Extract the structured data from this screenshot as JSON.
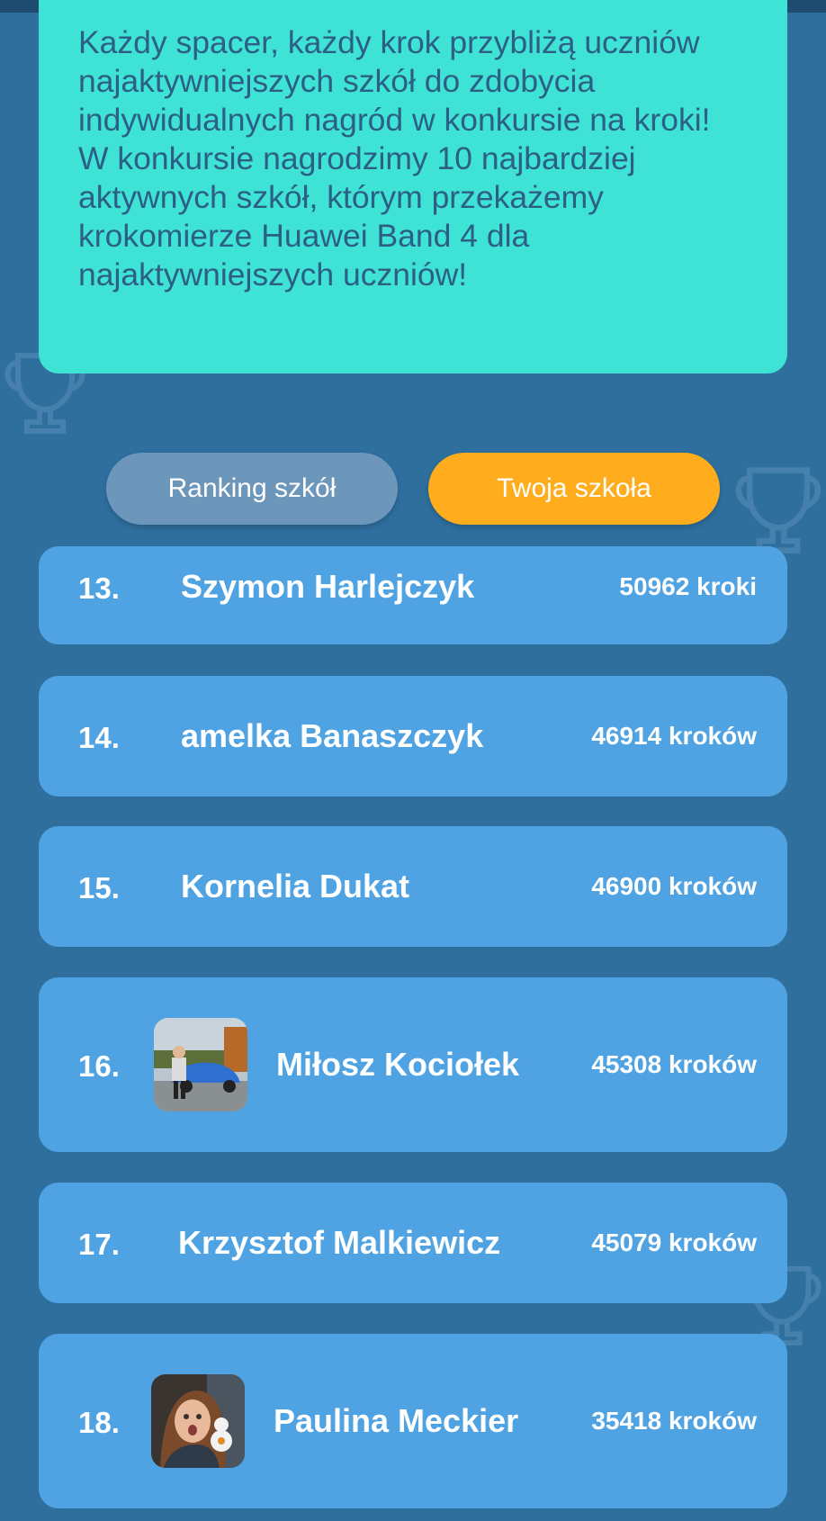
{
  "intro": {
    "text": "Każdy spacer, każdy krok przybliżą uczniów najaktywniejszych szkół do zdobycia indywidualnych nagród w konkursie na kroki! W konkursie nagrodzimy 10 najbardziej aktywnych szkół, którym przekażemy krokomierze Huawei Band 4 dla najaktywniejszych uczniów!"
  },
  "tabs": {
    "ranking_label": "Ranking szkół",
    "school_label": "Twoja szkoła",
    "active": "school"
  },
  "ranking": [
    {
      "rank": "13.",
      "name": "Szymon Harlejczyk",
      "steps": "50962 kroki",
      "avatar": null
    },
    {
      "rank": "14.",
      "name": "amelka Banaszczyk",
      "steps": "46914 kroków",
      "avatar": null
    },
    {
      "rank": "15.",
      "name": "Kornelia Dukat",
      "steps": "46900 kroków",
      "avatar": null
    },
    {
      "rank": "16.",
      "name": "Miłosz Kociołek",
      "steps": "45308 kroków",
      "avatar": "photo-car"
    },
    {
      "rank": "17.",
      "name": "Krzysztof Malkiewicz",
      "steps": "45079 kroków",
      "avatar": null
    },
    {
      "rank": "18.",
      "name": "Paulina Meckier",
      "steps": "35418 kroków",
      "avatar": "photo-portrait"
    }
  ],
  "colors": {
    "background": "#2e6f9e",
    "info_card": "#3ee3d6",
    "info_text": "#2d5f84",
    "row": "#4fa3e2",
    "tab_inactive": "#6c96ba",
    "tab_active": "#ffad1c"
  },
  "icons": [
    "trophy-icon"
  ]
}
